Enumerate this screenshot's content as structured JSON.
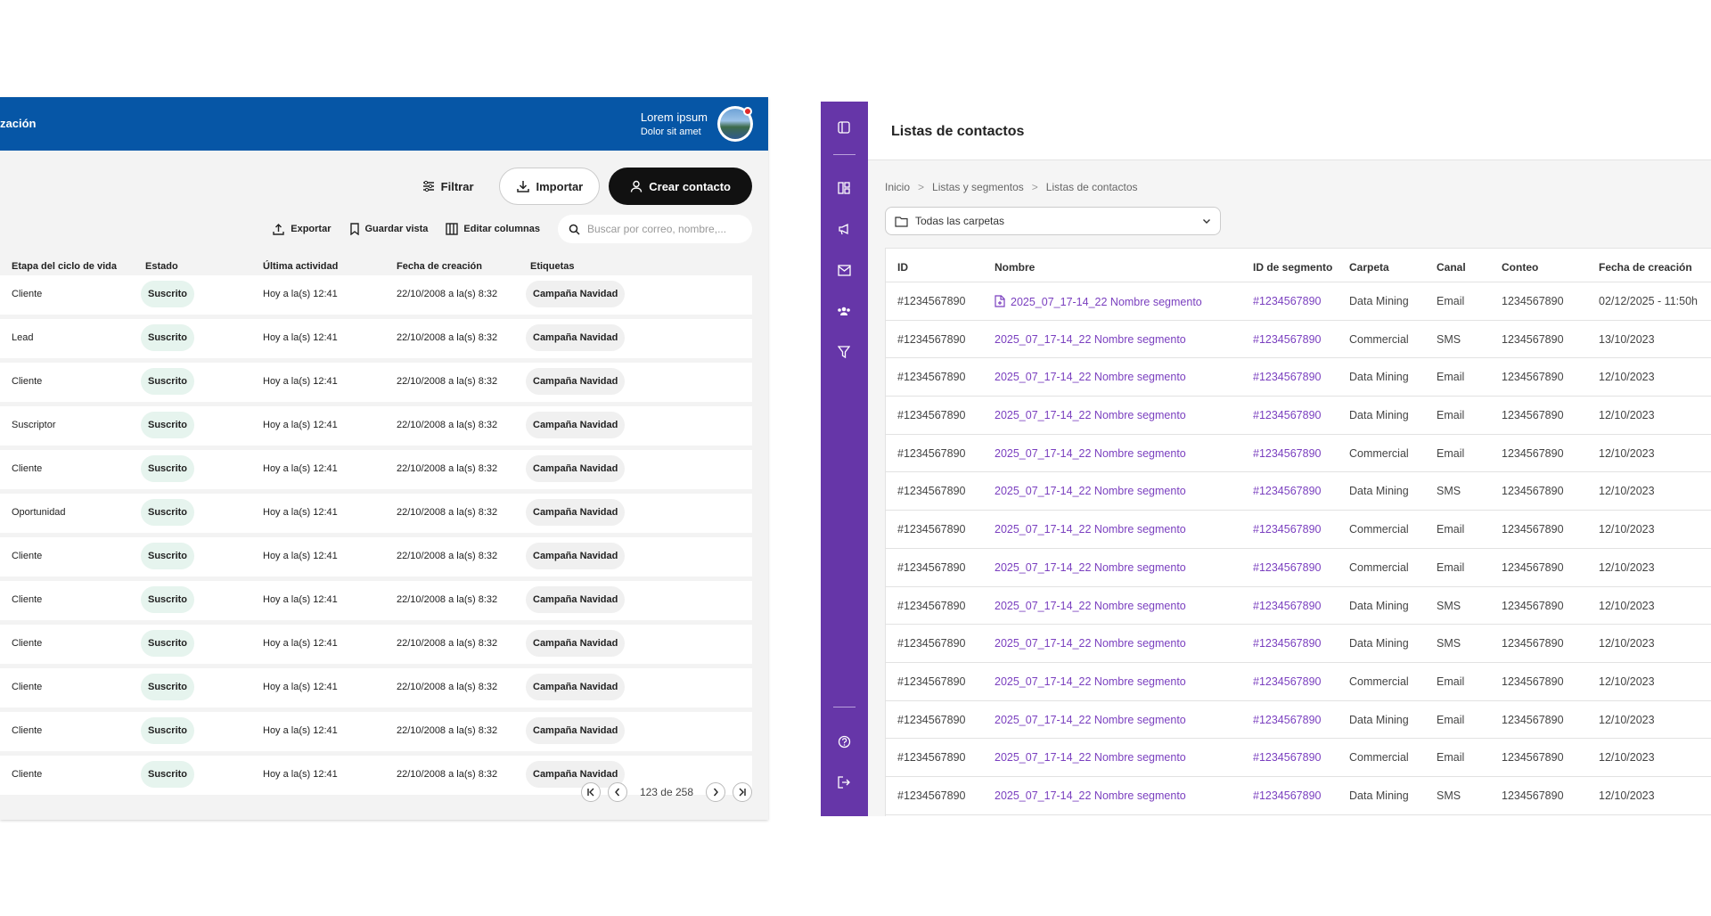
{
  "left": {
    "org_fragment": "zación",
    "user": {
      "name": "Lorem ipsum",
      "subtitle": "Dolor sit amet"
    },
    "actions": {
      "filter": "Filtrar",
      "import": "Importar",
      "create": "Crear contacto"
    },
    "tools": {
      "export": "Exportar",
      "save_view": "Guardar vista",
      "edit_columns": "Editar columnas",
      "search_placeholder": "Buscar por correo, nombre,..."
    },
    "columns": [
      "Etapa del ciclo de vida",
      "Estado",
      "Última actividad",
      "Fecha de creación",
      "Etiquetas"
    ],
    "rows": [
      {
        "stage": "Cliente",
        "status": "Suscrito",
        "activity": "Hoy a la(s) 12:41",
        "created": "22/10/2008 a la(s) 8:32",
        "tag": "Campaña Navidad"
      },
      {
        "stage": "Lead",
        "status": "Suscrito",
        "activity": "Hoy a la(s) 12:41",
        "created": "22/10/2008 a la(s) 8:32",
        "tag": "Campaña Navidad"
      },
      {
        "stage": "Cliente",
        "status": "Suscrito",
        "activity": "Hoy a la(s) 12:41",
        "created": "22/10/2008 a la(s) 8:32",
        "tag": "Campaña Navidad"
      },
      {
        "stage": "Suscriptor",
        "status": "Suscrito",
        "activity": "Hoy a la(s) 12:41",
        "created": "22/10/2008 a la(s) 8:32",
        "tag": "Campaña Navidad"
      },
      {
        "stage": "Cliente",
        "status": "Suscrito",
        "activity": "Hoy a la(s) 12:41",
        "created": "22/10/2008 a la(s) 8:32",
        "tag": "Campaña Navidad"
      },
      {
        "stage": "Oportunidad",
        "status": "Suscrito",
        "activity": "Hoy a la(s) 12:41",
        "created": "22/10/2008 a la(s) 8:32",
        "tag": "Campaña Navidad"
      },
      {
        "stage": "Cliente",
        "status": "Suscrito",
        "activity": "Hoy a la(s) 12:41",
        "created": "22/10/2008 a la(s) 8:32",
        "tag": "Campaña Navidad"
      },
      {
        "stage": "Cliente",
        "status": "Suscrito",
        "activity": "Hoy a la(s) 12:41",
        "created": "22/10/2008 a la(s) 8:32",
        "tag": "Campaña Navidad"
      },
      {
        "stage": "Cliente",
        "status": "Suscrito",
        "activity": "Hoy a la(s) 12:41",
        "created": "22/10/2008 a la(s) 8:32",
        "tag": "Campaña Navidad"
      },
      {
        "stage": "Cliente",
        "status": "Suscrito",
        "activity": "Hoy a la(s) 12:41",
        "created": "22/10/2008 a la(s) 8:32",
        "tag": "Campaña Navidad"
      },
      {
        "stage": "Cliente",
        "status": "Suscrito",
        "activity": "Hoy a la(s) 12:41",
        "created": "22/10/2008 a la(s) 8:32",
        "tag": "Campaña Navidad"
      },
      {
        "stage": "Cliente",
        "status": "Suscrito",
        "activity": "Hoy a la(s) 12:41",
        "created": "22/10/2008 a la(s) 8:32",
        "tag": "Campaña Navidad"
      }
    ],
    "pager": {
      "label": "123 de 258"
    },
    "colors": {
      "header": "#0656a6",
      "status_bg": "#e6f4ee",
      "tag_bg": "#f0f0f0"
    }
  },
  "right": {
    "title": "Listas de contactos",
    "sidebar_icons": [
      "sidebar-toggle-icon",
      "dashboard-icon",
      "megaphone-icon",
      "mail-icon",
      "people-icon",
      "funnel-icon",
      "help-icon",
      "logout-icon"
    ],
    "breadcrumb": [
      "Inicio",
      "Listas y segmentos",
      "Listas de contactos"
    ],
    "folder_select": "Todas las carpetas",
    "columns": [
      "ID",
      "Nombre",
      "ID de segmento",
      "Carpeta",
      "Canal",
      "Conteo",
      "Fecha de creación"
    ],
    "rows": [
      {
        "id": "#1234567890",
        "name": "2025_07_17-14_22 Nombre segmento",
        "seg": "#1234567890",
        "folder": "Data Mining",
        "channel": "Email",
        "count": "1234567890",
        "date": "02/12/2025 - 11:50h"
      },
      {
        "id": "#1234567890",
        "name": "2025_07_17-14_22 Nombre segmento",
        "seg": "#1234567890",
        "folder": "Commercial",
        "channel": "SMS",
        "count": "1234567890",
        "date": "13/10/2023"
      },
      {
        "id": "#1234567890",
        "name": "2025_07_17-14_22 Nombre segmento",
        "seg": "#1234567890",
        "folder": "Data Mining",
        "channel": "Email",
        "count": "1234567890",
        "date": "12/10/2023"
      },
      {
        "id": "#1234567890",
        "name": "2025_07_17-14_22 Nombre segmento",
        "seg": "#1234567890",
        "folder": "Data Mining",
        "channel": "Email",
        "count": "1234567890",
        "date": "12/10/2023"
      },
      {
        "id": "#1234567890",
        "name": "2025_07_17-14_22 Nombre segmento",
        "seg": "#1234567890",
        "folder": "Commercial",
        "channel": "Email",
        "count": "1234567890",
        "date": "12/10/2023"
      },
      {
        "id": "#1234567890",
        "name": "2025_07_17-14_22 Nombre segmento",
        "seg": "#1234567890",
        "folder": "Data Mining",
        "channel": "SMS",
        "count": "1234567890",
        "date": "12/10/2023"
      },
      {
        "id": "#1234567890",
        "name": "2025_07_17-14_22 Nombre segmento",
        "seg": "#1234567890",
        "folder": "Commercial",
        "channel": "Email",
        "count": "1234567890",
        "date": "12/10/2023"
      },
      {
        "id": "#1234567890",
        "name": "2025_07_17-14_22 Nombre segmento",
        "seg": "#1234567890",
        "folder": "Commercial",
        "channel": "Email",
        "count": "1234567890",
        "date": "12/10/2023"
      },
      {
        "id": "#1234567890",
        "name": "2025_07_17-14_22 Nombre segmento",
        "seg": "#1234567890",
        "folder": "Data Mining",
        "channel": "SMS",
        "count": "1234567890",
        "date": "12/10/2023"
      },
      {
        "id": "#1234567890",
        "name": "2025_07_17-14_22 Nombre segmento",
        "seg": "#1234567890",
        "folder": "Data Mining",
        "channel": "SMS",
        "count": "1234567890",
        "date": "12/10/2023"
      },
      {
        "id": "#1234567890",
        "name": "2025_07_17-14_22 Nombre segmento",
        "seg": "#1234567890",
        "folder": "Commercial",
        "channel": "Email",
        "count": "1234567890",
        "date": "12/10/2023"
      },
      {
        "id": "#1234567890",
        "name": "2025_07_17-14_22 Nombre segmento",
        "seg": "#1234567890",
        "folder": "Data Mining",
        "channel": "Email",
        "count": "1234567890",
        "date": "12/10/2023"
      },
      {
        "id": "#1234567890",
        "name": "2025_07_17-14_22 Nombre segmento",
        "seg": "#1234567890",
        "folder": "Commercial",
        "channel": "Email",
        "count": "1234567890",
        "date": "12/10/2023"
      },
      {
        "id": "#1234567890",
        "name": "2025_07_17-14_22 Nombre segmento",
        "seg": "#1234567890",
        "folder": "Data Mining",
        "channel": "SMS",
        "count": "1234567890",
        "date": "12/10/2023"
      }
    ],
    "colors": {
      "sidebar": "#6636a8",
      "link": "#7a3fbf"
    }
  }
}
